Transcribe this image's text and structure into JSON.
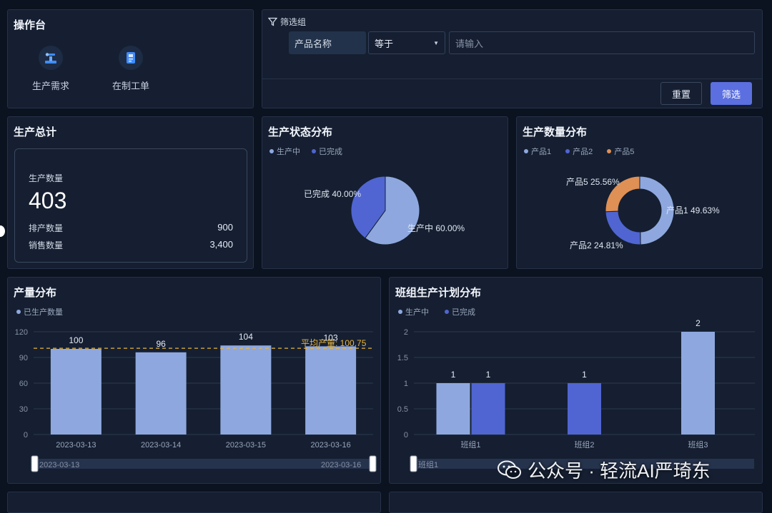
{
  "console": {
    "title": "操作台",
    "items": [
      {
        "label": "生产需求",
        "icon": "robot-arm-icon"
      },
      {
        "label": "在制工单",
        "icon": "document-icon"
      }
    ]
  },
  "filter": {
    "title": "筛选组",
    "field_label": "产品名称",
    "operator": "等于",
    "input_placeholder": "请输入",
    "reset_label": "重置",
    "apply_label": "筛选"
  },
  "summary": {
    "title": "生产总计",
    "main_label": "生产数量",
    "main_value": "403",
    "rows": [
      {
        "label": "排产数量",
        "value": "900"
      },
      {
        "label": "销售数量",
        "value": "3,400"
      }
    ]
  },
  "status_pie": {
    "title": "生产状态分布",
    "legend": [
      "生产中",
      "已完成"
    ],
    "labels": [
      "生产中 60.00%",
      "已完成 40.00%"
    ]
  },
  "qty_donut": {
    "title": "生产数量分布",
    "legend": [
      "产品1",
      "产品2",
      "产品5"
    ],
    "labels": [
      "产品1 49.63%",
      "产品2 24.81%",
      "产品5 25.56%"
    ]
  },
  "output_bar": {
    "title": "产量分布",
    "legend": [
      "已生产数量"
    ],
    "avg_label": "平均产量: 100.75",
    "zoom_start": "2023-03-13",
    "zoom_end": "2023-03-16"
  },
  "team_bar": {
    "title": "班组生产计划分布",
    "legend": [
      "生产中",
      "已完成"
    ],
    "zoom_start": "班组1"
  },
  "watermark": {
    "text": "公众号 · 轻流AI严琦东"
  },
  "colors": {
    "light": "#8ea8df",
    "blue": "#5065d1",
    "orange": "#df9055",
    "accent": "#5b6fe0",
    "avg": "#e9b43d"
  },
  "chart_data": [
    {
      "type": "pie",
      "title": "生产状态分布",
      "categories": [
        "生产中",
        "已完成"
      ],
      "values": [
        60.0,
        40.0
      ]
    },
    {
      "type": "pie",
      "title": "生产数量分布",
      "categories": [
        "产品1",
        "产品2",
        "产品5"
      ],
      "values": [
        49.63,
        24.81,
        25.56
      ]
    },
    {
      "type": "bar",
      "title": "产量分布",
      "categories": [
        "2023-03-13",
        "2023-03-14",
        "2023-03-15",
        "2023-03-16"
      ],
      "series": [
        {
          "name": "已生产数量",
          "values": [
            100,
            96,
            104,
            103
          ]
        }
      ],
      "average": 100.75,
      "ylim": [
        0,
        120
      ],
      "yticks": [
        0,
        30,
        60,
        90,
        120
      ],
      "grid": true,
      "legend": "top-left"
    },
    {
      "type": "bar",
      "title": "班组生产计划分布",
      "categories": [
        "班组1",
        "班组2",
        "班组3"
      ],
      "series": [
        {
          "name": "生产中",
          "values": [
            1,
            null,
            2
          ]
        },
        {
          "name": "已完成",
          "values": [
            1,
            1,
            null
          ]
        }
      ],
      "ylim": [
        0,
        2
      ],
      "yticks": [
        0,
        0.5,
        1,
        1.5,
        2
      ],
      "grid": true,
      "legend": "top-left"
    }
  ]
}
